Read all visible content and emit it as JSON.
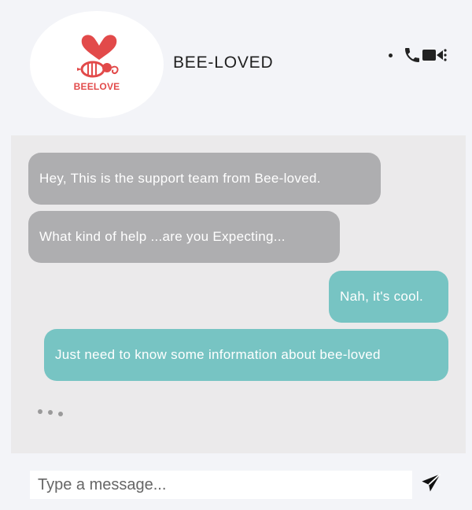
{
  "header": {
    "logo_text": "BEELOVE",
    "contact_name": "BEE-LOVED",
    "icons": [
      "more-dot-icon",
      "phone-icon",
      "video-camera-icon"
    ]
  },
  "messages": [
    {
      "direction": "in",
      "text": "Hey, This is the support team from Bee-loved."
    },
    {
      "direction": "in",
      "text": "What kind of help ...are you Expecting..."
    },
    {
      "direction": "out",
      "text": "Nah, it's cool."
    },
    {
      "direction": "out",
      "text": "Just need to know some information about bee-loved"
    }
  ],
  "typing_indicator": "...",
  "composer": {
    "placeholder": "Type a message...",
    "send_icon": "send-icon"
  },
  "colors": {
    "incoming_bubble": "#aeaeb0",
    "outgoing_bubble": "#77c4c3",
    "logo_red": "#e24a4a",
    "chat_background": "#ebeaeb",
    "page_background": "#f3f4f8"
  }
}
